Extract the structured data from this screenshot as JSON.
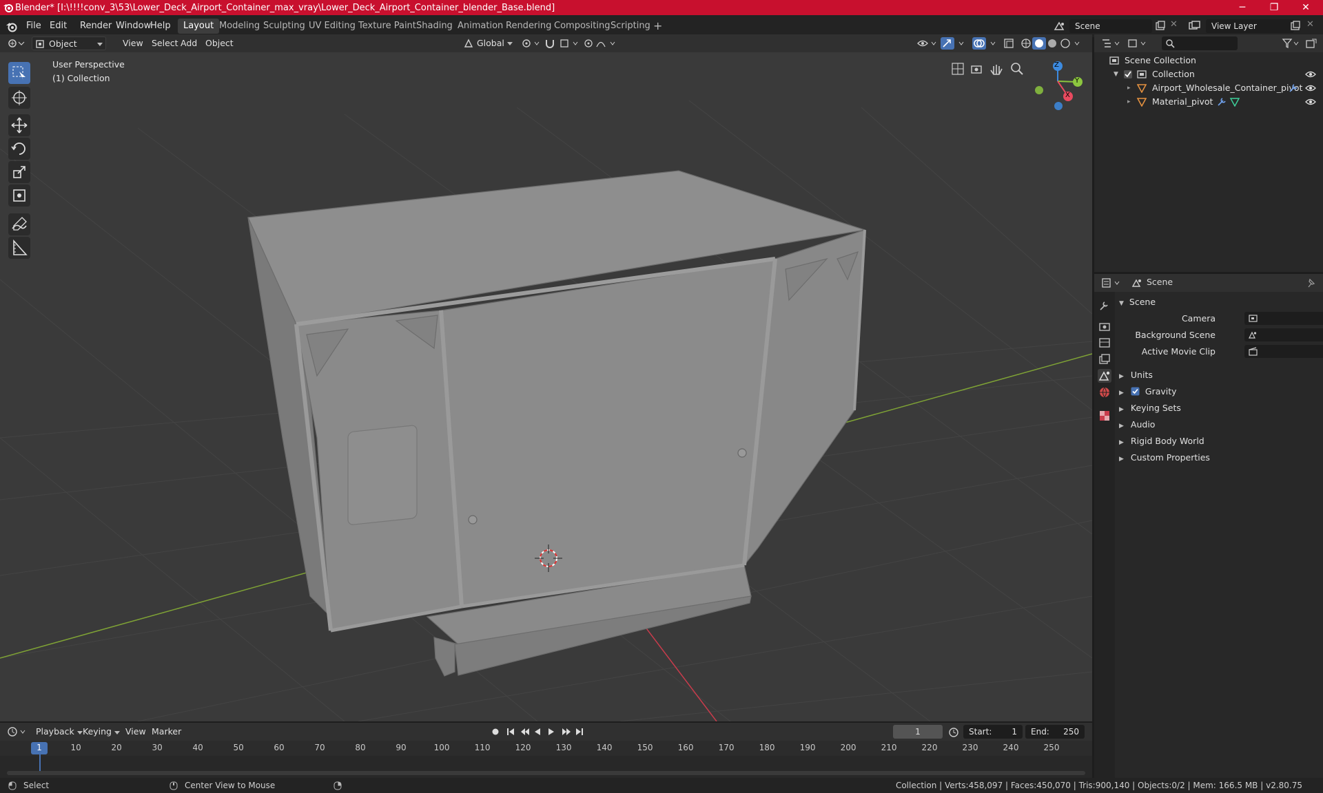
{
  "window": {
    "title": "Blender* [I:\\!!!!conv_3\\53\\Lower_Deck_Airport_Container_max_vray\\Lower_Deck_Airport_Container_blender_Base.blend]",
    "minimize": "─",
    "maximize": "❐",
    "close": "✕"
  },
  "menu": [
    "File",
    "Edit",
    "Render",
    "Window",
    "Help"
  ],
  "workspaces": [
    "Layout",
    "Modeling",
    "Sculpting",
    "UV Editing",
    "Texture Paint",
    "Shading",
    "Animation",
    "Rendering",
    "Compositing",
    "Scripting"
  ],
  "active_workspace": "Layout",
  "add_workspace": "+",
  "scene_field": "Scene",
  "view_layer_field": "View Layer",
  "viewport_header": {
    "mode": "Object Mode",
    "menus": [
      "View",
      "Select",
      "Add",
      "Object"
    ],
    "transform_orientation": "Global"
  },
  "viewport": {
    "perspective_label": "User Perspective",
    "collection_label": "(1) Collection",
    "gizmo_axes": {
      "z": "Z",
      "y": "Y",
      "x": "X"
    }
  },
  "outliner": {
    "root": "Scene Collection",
    "collection": "Collection",
    "objects": [
      "Airport_Wholesale_Container_pivot",
      "Material_pivot"
    ]
  },
  "properties": {
    "context": "Scene",
    "panel": "Scene",
    "fields": [
      {
        "label": "Camera"
      },
      {
        "label": "Background Scene"
      },
      {
        "label": "Active Movie Clip"
      }
    ],
    "subpanels": [
      "Units",
      "Gravity",
      "Keying Sets",
      "Audio",
      "Rigid Body World",
      "Custom Properties"
    ],
    "gravity_checked": true
  },
  "timeline": {
    "menus": [
      "Playback",
      "Keying",
      "View",
      "Marker"
    ],
    "current_frame": "1",
    "start_label": "Start:",
    "start": "1",
    "end_label": "End:",
    "end": "250",
    "ruler_labels": [
      "1",
      "10",
      "20",
      "30",
      "40",
      "50",
      "60",
      "70",
      "80",
      "90",
      "100",
      "110",
      "120",
      "130",
      "140",
      "150",
      "160",
      "170",
      "180",
      "190",
      "200",
      "210",
      "220",
      "230",
      "240",
      "250"
    ]
  },
  "statusbar": {
    "left_action": "Select",
    "mid_action": "Center View to Mouse",
    "stats": "Collection | Verts:458,097 | Faces:450,070 | Tris:900,140 | Objects:0/2 | Mem: 166.5 MB | v2.80.75"
  },
  "colors": {
    "title_bar": "#c8102e",
    "accent": "#4772b3",
    "x_axis": "#e84a5f",
    "y_axis": "#8cc63f",
    "z_axis": "#3d8be0"
  }
}
